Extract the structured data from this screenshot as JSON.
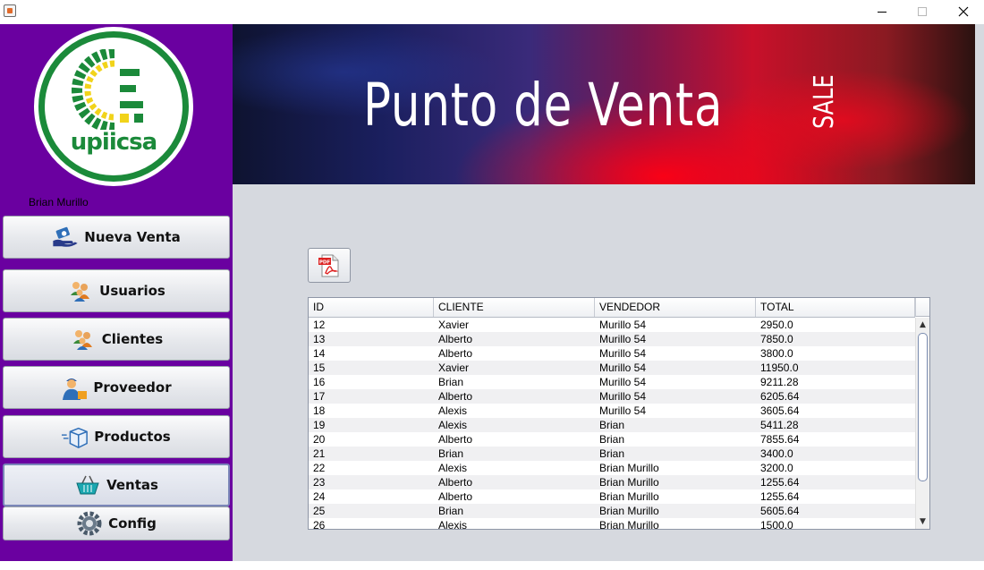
{
  "window": {
    "title": "",
    "minimize_glyph": "—",
    "maximize_glyph": "☐",
    "close_glyph": "✕"
  },
  "sidebar": {
    "logo_text": "upiicsa",
    "username": "Brian Murillo",
    "items": [
      {
        "label": "Nueva Venta",
        "icon": "hand-money-icon"
      },
      {
        "label": "Usuarios",
        "icon": "users-icon"
      },
      {
        "label": "Clientes",
        "icon": "clients-icon"
      },
      {
        "label": "Proveedor",
        "icon": "delivery-person-icon"
      },
      {
        "label": "Productos",
        "icon": "box-icon"
      },
      {
        "label": "Ventas",
        "icon": "basket-icon",
        "active": true
      },
      {
        "label": "Config",
        "icon": "gear-icon"
      }
    ]
  },
  "banner": {
    "title": "Punto de Venta",
    "tag": "SALE"
  },
  "toolbar": {
    "pdf_icon": "pdf-icon",
    "pdf_badge": "PDF"
  },
  "table": {
    "columns": [
      "ID",
      "CLIENTE",
      "VENDEDOR",
      "TOTAL"
    ],
    "rows": [
      [
        "12",
        "Xavier",
        "Murillo 54",
        "2950.0"
      ],
      [
        "13",
        "Alberto",
        "Murillo 54",
        "7850.0"
      ],
      [
        "14",
        "Alberto",
        "Murillo 54",
        "3800.0"
      ],
      [
        "15",
        "Xavier",
        "Murillo 54",
        "11950.0"
      ],
      [
        "16",
        "Brian",
        "Murillo 54",
        "9211.28"
      ],
      [
        "17",
        "Alberto",
        "Murillo 54",
        "6205.64"
      ],
      [
        "18",
        "Alexis",
        "Murillo 54",
        "3605.64"
      ],
      [
        "19",
        "Alexis",
        "Brian",
        "5411.28"
      ],
      [
        "20",
        "Alberto",
        "Brian",
        "7855.64"
      ],
      [
        "21",
        "Brian",
        "Brian",
        "3400.0"
      ],
      [
        "22",
        "Alexis",
        "Brian Murillo",
        "3200.0"
      ],
      [
        "23",
        "Alberto",
        "Brian Murillo",
        "1255.64"
      ],
      [
        "24",
        "Alberto",
        "Brian Murillo",
        "1255.64"
      ],
      [
        "25",
        "Brian",
        "Brian Murillo",
        "5605.64"
      ],
      [
        "26",
        "Alexis",
        "Brian Murillo",
        "1500.0"
      ]
    ]
  },
  "colors": {
    "sidebar": "#6a00a0",
    "main_bg": "#d6d9df",
    "logo_green": "#1b8a3a"
  }
}
